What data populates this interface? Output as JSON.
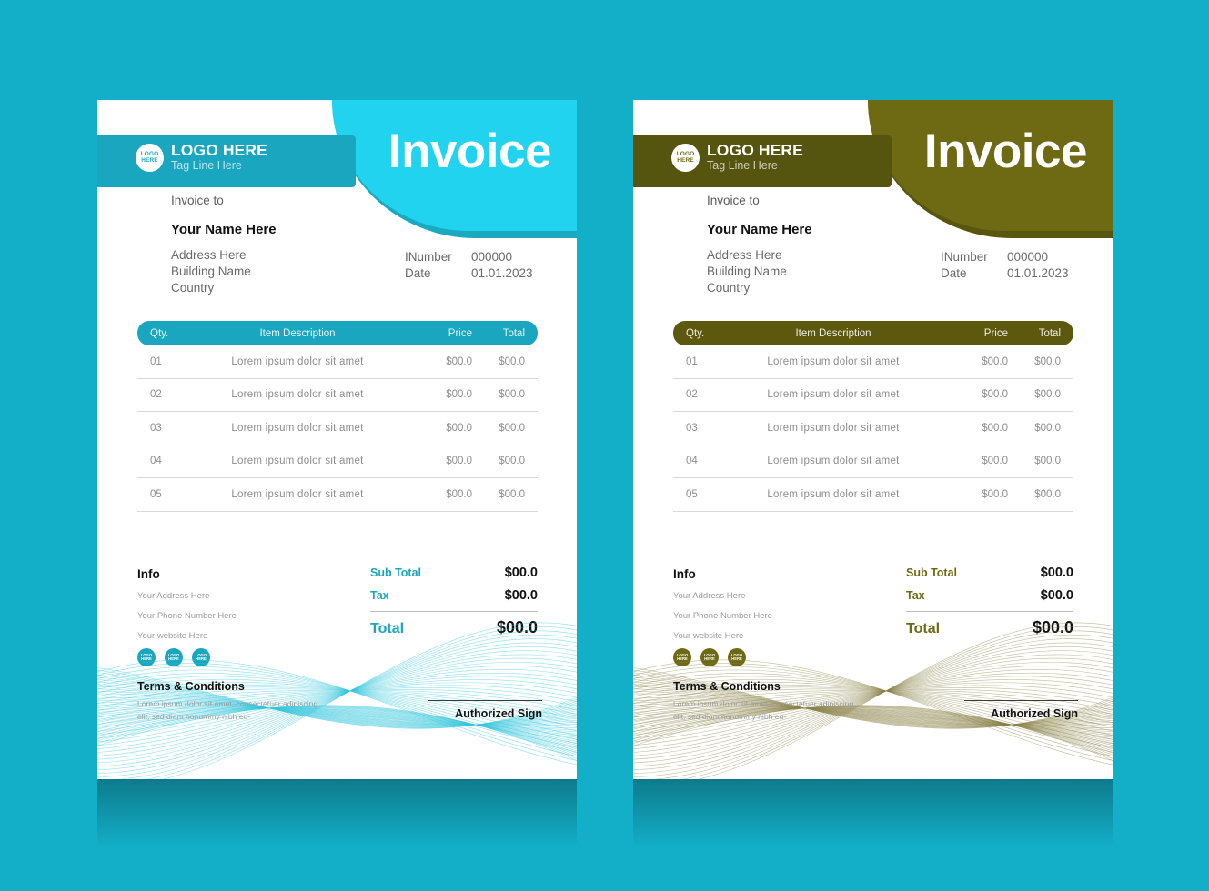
{
  "background_color": "#13AFC8",
  "invoices": [
    {
      "id": "invoice-teal",
      "theme": {
        "bar": "#1AA6BF",
        "curve": "#22D3F0",
        "accent": "#1AA6BF",
        "table_header": "#1AA6BF",
        "badge_text": "#1AA6BF",
        "wave": "#35C6DC"
      },
      "header": {
        "logo_line1": "LOGO HERE",
        "logo_line2": "Tag Line Here",
        "badge_line1": "LOGO",
        "badge_line2": "HERE",
        "title": "Invoice"
      },
      "billto": {
        "label": "Invoice to",
        "name": "Your Name Here",
        "address": [
          "Address Here",
          "Building Name",
          "Country"
        ]
      },
      "meta": [
        {
          "key": "INumber",
          "value": "000000"
        },
        {
          "key": "Date",
          "value": "01.01.2023"
        }
      ],
      "table": {
        "columns": [
          "Qty.",
          "Item Description",
          "Price",
          "Total"
        ],
        "rows": [
          {
            "qty": "01",
            "desc": "Lorem ipsum dolor sit amet",
            "price": "$00.0",
            "total": "$00.0"
          },
          {
            "qty": "02",
            "desc": "Lorem ipsum dolor sit amet",
            "price": "$00.0",
            "total": "$00.0"
          },
          {
            "qty": "03",
            "desc": "Lorem ipsum dolor sit amet",
            "price": "$00.0",
            "total": "$00.0"
          },
          {
            "qty": "04",
            "desc": "Lorem ipsum dolor sit amet",
            "price": "$00.0",
            "total": "$00.0"
          },
          {
            "qty": "05",
            "desc": "Lorem ipsum dolor sit amet",
            "price": "$00.0",
            "total": "$00.0"
          }
        ]
      },
      "info": {
        "title": "Info",
        "lines": [
          "Your Address Here",
          "Your Phone Number Here",
          "Your website Here"
        ]
      },
      "socials": [
        {
          "line1": "LOGO",
          "line2": "HERE"
        },
        {
          "line1": "LOGO",
          "line2": "HERE"
        },
        {
          "line1": "LOGO",
          "line2": "HERE"
        }
      ],
      "totals": [
        {
          "label": "Sub Total",
          "value": "$00.0"
        },
        {
          "label": "Tax",
          "value": "$00.0"
        },
        {
          "label": "Total",
          "value": "$00.0"
        }
      ],
      "terms": {
        "title": "Terms & Conditions",
        "body": "Lorem ipsum dolor sit amet, consectetuer adipiscing elit, sed diam nonummy nibh eu-"
      },
      "sign": {
        "label": "Authorized Sign"
      }
    },
    {
      "id": "invoice-olive",
      "theme": {
        "bar": "#55550F",
        "curve": "#6E6A13",
        "accent": "#6E6A13",
        "table_header": "#5C590F",
        "badge_text": "#6E6A13",
        "wave": "#8A8449"
      },
      "header": {
        "logo_line1": "LOGO HERE",
        "logo_line2": "Tag Line Here",
        "badge_line1": "LOGO",
        "badge_line2": "HERE",
        "title": "Invoice"
      },
      "billto": {
        "label": "Invoice to",
        "name": "Your Name Here",
        "address": [
          "Address Here",
          "Building Name",
          "Country"
        ]
      },
      "meta": [
        {
          "key": "INumber",
          "value": "000000"
        },
        {
          "key": "Date",
          "value": "01.01.2023"
        }
      ],
      "table": {
        "columns": [
          "Qty.",
          "Item Description",
          "Price",
          "Total"
        ],
        "rows": [
          {
            "qty": "01",
            "desc": "Lorem ipsum dolor sit amet",
            "price": "$00.0",
            "total": "$00.0"
          },
          {
            "qty": "02",
            "desc": "Lorem ipsum dolor sit amet",
            "price": "$00.0",
            "total": "$00.0"
          },
          {
            "qty": "03",
            "desc": "Lorem ipsum dolor sit amet",
            "price": "$00.0",
            "total": "$00.0"
          },
          {
            "qty": "04",
            "desc": "Lorem ipsum dolor sit amet",
            "price": "$00.0",
            "total": "$00.0"
          },
          {
            "qty": "05",
            "desc": "Lorem ipsum dolor sit amet",
            "price": "$00.0",
            "total": "$00.0"
          }
        ]
      },
      "info": {
        "title": "Info",
        "lines": [
          "Your Address Here",
          "Your Phone Number Here",
          "Your website Here"
        ]
      },
      "socials": [
        {
          "line1": "LOGO",
          "line2": "HERE"
        },
        {
          "line1": "LOGO",
          "line2": "HERE"
        },
        {
          "line1": "LOGO",
          "line2": "HERE"
        }
      ],
      "totals": [
        {
          "label": "Sub Total",
          "value": "$00.0"
        },
        {
          "label": "Tax",
          "value": "$00.0"
        },
        {
          "label": "Total",
          "value": "$00.0"
        }
      ],
      "terms": {
        "title": "Terms & Conditions",
        "body": "Lorem ipsum dolor sit amet, consectetuer adipiscing elit, sed diam nonummy nibh eu-"
      },
      "sign": {
        "label": "Authorized Sign"
      }
    }
  ]
}
